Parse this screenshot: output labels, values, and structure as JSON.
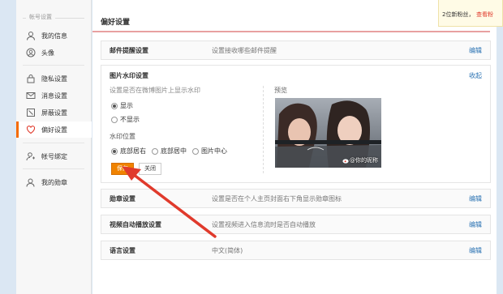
{
  "sidebar": {
    "section_title": "帐号设置",
    "items": [
      {
        "label": "我的信息",
        "icon": "user-icon"
      },
      {
        "label": "头像",
        "icon": "avatar-icon"
      },
      {
        "label": "隐私设置",
        "icon": "lock-icon"
      },
      {
        "label": "消息设置",
        "icon": "message-icon"
      },
      {
        "label": "屏蔽设置",
        "icon": "block-icon"
      },
      {
        "label": "偏好设置",
        "icon": "heart-icon"
      },
      {
        "label": "帐号绑定",
        "icon": "user-link-icon"
      },
      {
        "label": "我的勋章",
        "icon": "medal-icon"
      }
    ],
    "active_index": 5
  },
  "main": {
    "title": "偏好设置",
    "rows": {
      "mail": {
        "name": "邮件提醒设置",
        "desc": "设置接收哪些邮件提醒",
        "action": "编辑"
      },
      "medal": {
        "name": "勋章设置",
        "desc": "设置是否在个人主页封面右下角显示勋章图标",
        "action": "编辑"
      },
      "video": {
        "name": "视频自动播放设置",
        "desc": "设置视频进入信息流时是否自动播放",
        "action": "编辑"
      },
      "language": {
        "name": "语言设置",
        "desc": "中文(简体)",
        "action": "编辑"
      }
    },
    "watermark": {
      "name": "图片水印设置",
      "collapse": "收起",
      "hint": "设置是否在微博图片上显示水印",
      "show_options": [
        {
          "label": "显示",
          "checked": true
        },
        {
          "label": "不显示",
          "checked": false
        }
      ],
      "position_title": "水印位置",
      "position_options": [
        {
          "label": "底部居右",
          "checked": true
        },
        {
          "label": "底部居中",
          "checked": false
        },
        {
          "label": "图片中心",
          "checked": false
        }
      ],
      "save": "保存",
      "close": "关闭",
      "preview_label": "预览",
      "preview_watermark": "@你的昵称"
    }
  },
  "notify": {
    "text": "2位新粉丝，",
    "link": "查看粉"
  },
  "colors": {
    "accent": "#f08300",
    "link": "#2b73b3",
    "arrow": "#e03a2c"
  }
}
